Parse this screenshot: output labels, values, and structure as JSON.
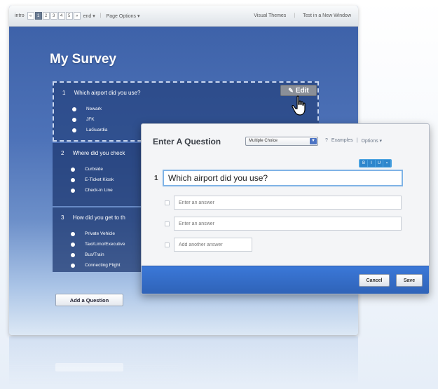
{
  "toolbar": {
    "intro": "intro",
    "steps": [
      "«",
      "1",
      "2",
      "3",
      "4",
      "5",
      "»"
    ],
    "end": "end ▾",
    "page_options": "Page Options ▾",
    "visual_themes": "Visual Themes",
    "test_window": "Test in a New Window"
  },
  "survey": {
    "title": "My Survey",
    "questions": [
      {
        "num": "1",
        "text": "Which airport did you use?",
        "answers": [
          "Newark",
          "JFK",
          "LaGuardia"
        ]
      },
      {
        "num": "2",
        "text": "Where did you check",
        "answers": [
          "Curbside",
          "E-Ticket Kiosk",
          "Check-in Line"
        ]
      },
      {
        "num": "3",
        "text": "How did you get to th",
        "answers": [
          "Private Vehicle",
          "Taxi/Limo/Executive",
          "Bus/Train",
          "Connecting Flight"
        ]
      }
    ],
    "edit_label": "Edit",
    "add_question": "Add a Question"
  },
  "dialog": {
    "title": "Enter A Question",
    "type_selected": "Multiple Choice",
    "help": "?",
    "examples": "Examples",
    "options": "Options ▾",
    "format_buttons": [
      "B",
      "I",
      "U",
      "▪"
    ],
    "question_number": "1",
    "question_value": "Which airport did you use?",
    "answer_placeholder": "Enter an answer",
    "add_answer_placeholder": "Add another answer",
    "cancel": "Cancel",
    "save": "Save"
  },
  "colors": {
    "accent": "#2f63b8",
    "survey_bg": "#4d72b8",
    "input_focus": "#7fb3e6"
  }
}
